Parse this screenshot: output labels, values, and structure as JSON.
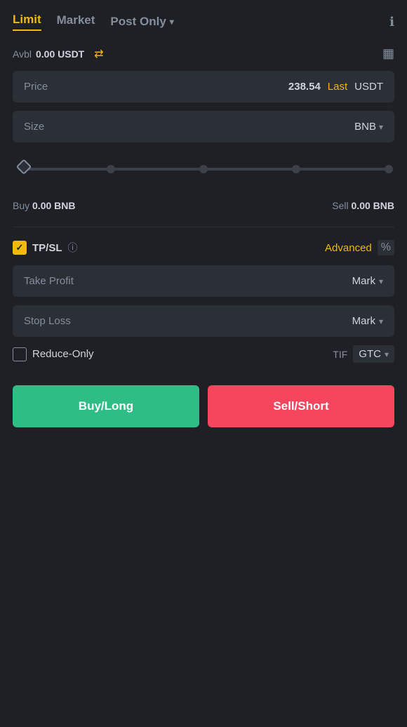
{
  "tabs": {
    "limit": "Limit",
    "market": "Market",
    "postOnly": "Post Only",
    "activeTab": "limit"
  },
  "info_icon": "ℹ",
  "balance": {
    "label": "Avbl",
    "value": "0.00",
    "unit": "USDT"
  },
  "price_field": {
    "label": "Price",
    "value": "238.54",
    "tag": "Last",
    "unit": "USDT"
  },
  "size_field": {
    "label": "Size",
    "unit": "BNB"
  },
  "slider": {
    "value": 0
  },
  "buy_sell": {
    "buy_label": "Buy",
    "buy_value": "0.00",
    "buy_unit": "BNB",
    "sell_label": "Sell",
    "sell_value": "0.00",
    "sell_unit": "BNB"
  },
  "tpsl": {
    "label": "TP/SL",
    "advanced": "Advanced"
  },
  "take_profit": {
    "label": "Take Profit",
    "unit": "Mark"
  },
  "stop_loss": {
    "label": "Stop Loss",
    "unit": "Mark"
  },
  "reduce_only": {
    "label": "Reduce-Only",
    "tif_label": "TIF",
    "tif_value": "GTC"
  },
  "buttons": {
    "buy": "Buy/Long",
    "sell": "Sell/Short"
  }
}
